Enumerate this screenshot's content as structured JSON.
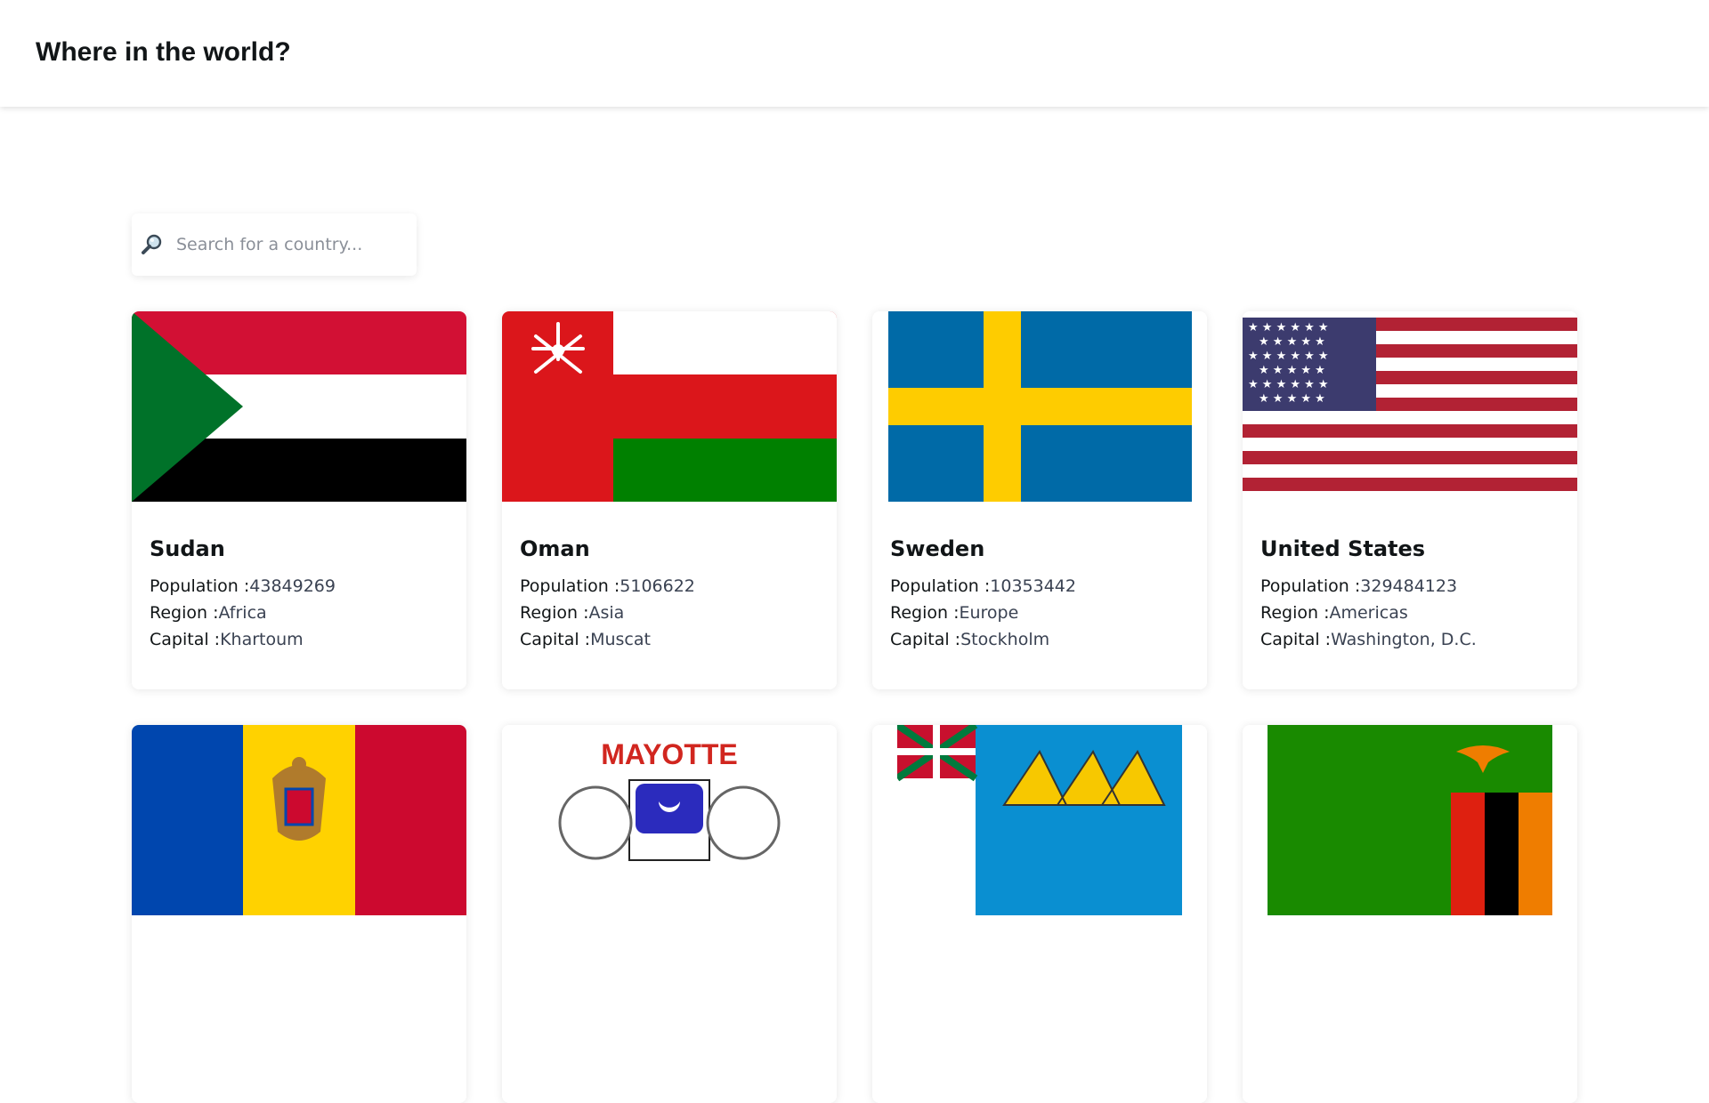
{
  "header": {
    "title": "Where in the world?"
  },
  "search": {
    "placeholder": "Search for a country..."
  },
  "labels": {
    "population": "Population :",
    "region": "Region :",
    "capital": "Capital :"
  },
  "countries": [
    {
      "name": "Sudan",
      "population": "43849269",
      "region": "Africa",
      "capital": "Khartoum"
    },
    {
      "name": "Oman",
      "population": "5106622",
      "region": "Asia",
      "capital": "Muscat"
    },
    {
      "name": "Sweden",
      "population": "10353442",
      "region": "Europe",
      "capital": "Stockholm"
    },
    {
      "name": "United States",
      "population": "329484123",
      "region": "Americas",
      "capital": "Washington, D.C."
    }
  ],
  "second_row_flags": [
    {
      "flag": "moldova-flag"
    },
    {
      "flag": "mayotte-flag",
      "text": "MAYOTTE"
    },
    {
      "flag": "saint-pierre-miquelon-flag"
    },
    {
      "flag": "zambia-flag"
    }
  ],
  "colors": {
    "text": "#111517",
    "value": "#3a4252",
    "placeholder": "#8a8f98"
  }
}
